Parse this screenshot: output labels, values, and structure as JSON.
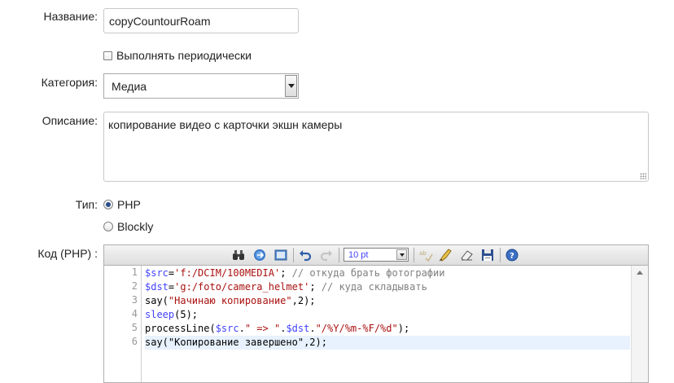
{
  "form": {
    "name_label": "Название:",
    "name_value": "copyCountourRoam",
    "periodic_label": "Выполнять периодически",
    "periodic_checked": false,
    "category_label": "Категория:",
    "category_value": "Медиа",
    "description_label": "Описание:",
    "description_value": "копирование видео с карточки экшн камеры",
    "type_label": "Тип:",
    "type_options": [
      {
        "label": "PHP",
        "selected": true
      },
      {
        "label": "Blockly",
        "selected": false
      }
    ],
    "code_label": "Код (PHP) :"
  },
  "editor": {
    "font_size": "10 pt",
    "toolbar_icons": [
      "binoculars-icon",
      "goto-icon",
      "fullscreen-icon",
      "undo-icon",
      "redo-icon",
      "font-size-select",
      "spellcheck-icon",
      "highlight-icon",
      "eraser-icon",
      "save-icon",
      "help-icon"
    ],
    "line_numbers": [
      "1",
      "2",
      "3",
      "4",
      "5",
      "6"
    ],
    "active_line": 6
  },
  "colors": {
    "variable": "#0000ff",
    "string": "#aa1111",
    "comment": "#808080",
    "active_line_bg": "#e8f2fe"
  }
}
